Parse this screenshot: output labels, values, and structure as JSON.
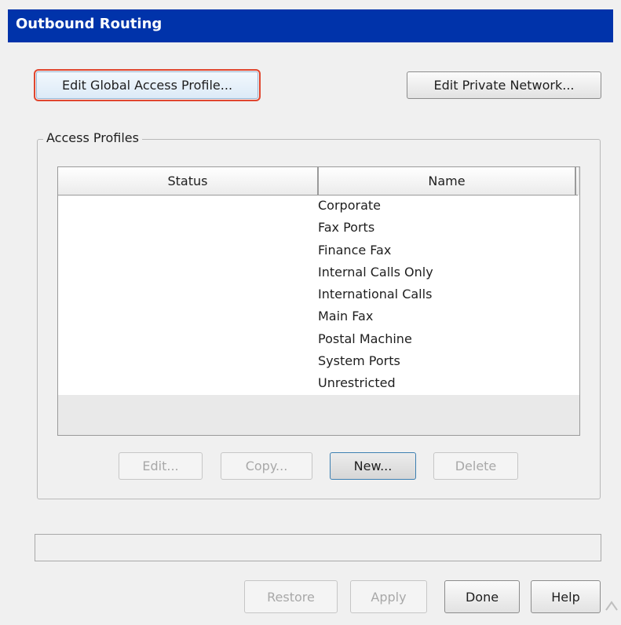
{
  "window": {
    "title": "Outbound Routing"
  },
  "toolbar": {
    "edit_global_label": "Edit Global Access Profile...",
    "edit_private_label": "Edit Private Network..."
  },
  "access_profiles": {
    "legend": "Access Profiles",
    "columns": [
      "Status",
      "Name"
    ],
    "rows": [
      {
        "status": "",
        "name": "Corporate"
      },
      {
        "status": "",
        "name": "Fax Ports"
      },
      {
        "status": "",
        "name": "Finance Fax"
      },
      {
        "status": "",
        "name": "Internal Calls Only"
      },
      {
        "status": "",
        "name": "International Calls"
      },
      {
        "status": "",
        "name": "Main Fax"
      },
      {
        "status": "",
        "name": "Postal Machine"
      },
      {
        "status": "",
        "name": "System Ports"
      },
      {
        "status": "",
        "name": "Unrestricted"
      }
    ],
    "buttons": {
      "edit": "Edit...",
      "copy": "Copy...",
      "new": "New...",
      "delete": "Delete"
    }
  },
  "status_text": "",
  "footer": {
    "restore": "Restore",
    "apply": "Apply",
    "done": "Done",
    "help": "Help"
  },
  "colors": {
    "titlebar": "#0033aa",
    "highlight_outline": "#e0462f"
  }
}
